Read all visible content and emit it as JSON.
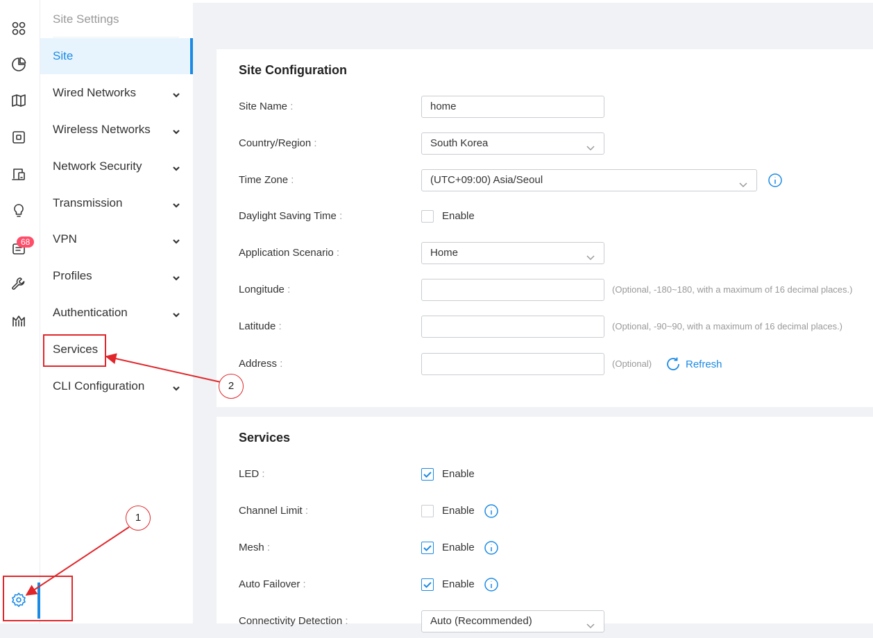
{
  "rail": {
    "icons": [
      "dashboard-icon",
      "statistics-icon",
      "map-icon",
      "devices-icon",
      "clients-icon",
      "insights-icon",
      "logs-icon",
      "tools-icon",
      "reports-icon",
      "settings-icon"
    ],
    "badge": "68"
  },
  "submenu": {
    "title": "Site Settings",
    "items": [
      {
        "label": "Site",
        "active": true
      },
      {
        "label": "Wired Networks"
      },
      {
        "label": "Wireless Networks"
      },
      {
        "label": "Network Security"
      },
      {
        "label": "Transmission"
      },
      {
        "label": "VPN"
      },
      {
        "label": "Profiles"
      },
      {
        "label": "Authentication"
      },
      {
        "label": "Services"
      },
      {
        "label": "CLI Configuration"
      }
    ]
  },
  "site_config": {
    "title": "Site Configuration",
    "site_name": {
      "label": "Site Name",
      "value": "home"
    },
    "country": {
      "label": "Country/Region",
      "value": "South Korea"
    },
    "time_zone": {
      "label": "Time Zone",
      "value": "(UTC+09:00) Asia/Seoul"
    },
    "dst": {
      "label": "Daylight Saving Time",
      "option": "Enable",
      "checked": false
    },
    "scenario": {
      "label": "Application Scenario",
      "value": "Home"
    },
    "longitude": {
      "label": "Longitude",
      "value": "",
      "hint": "(Optional, -180~180, with a maximum of 16 decimal places.)"
    },
    "latitude": {
      "label": "Latitude",
      "value": "",
      "hint": "(Optional, -90~90, with a maximum of 16 decimal places.)"
    },
    "address": {
      "label": "Address",
      "value": "",
      "hint": "(Optional)",
      "refresh": "Refresh"
    }
  },
  "services": {
    "title": "Services",
    "led": {
      "label": "LED",
      "option": "Enable",
      "checked": true
    },
    "channel_limit": {
      "label": "Channel Limit",
      "option": "Enable",
      "checked": false
    },
    "mesh": {
      "label": "Mesh",
      "option": "Enable",
      "checked": true
    },
    "auto_failover": {
      "label": "Auto Failover",
      "option": "Enable",
      "checked": true
    },
    "connectivity": {
      "label": "Connectivity Detection",
      "value": "Auto (Recommended)"
    }
  },
  "annotations": {
    "step1": "1",
    "step2": "2"
  },
  "colors": {
    "accent": "#1a8ae5",
    "annotation": "#e0262a",
    "badge": "#ff4d6a"
  }
}
